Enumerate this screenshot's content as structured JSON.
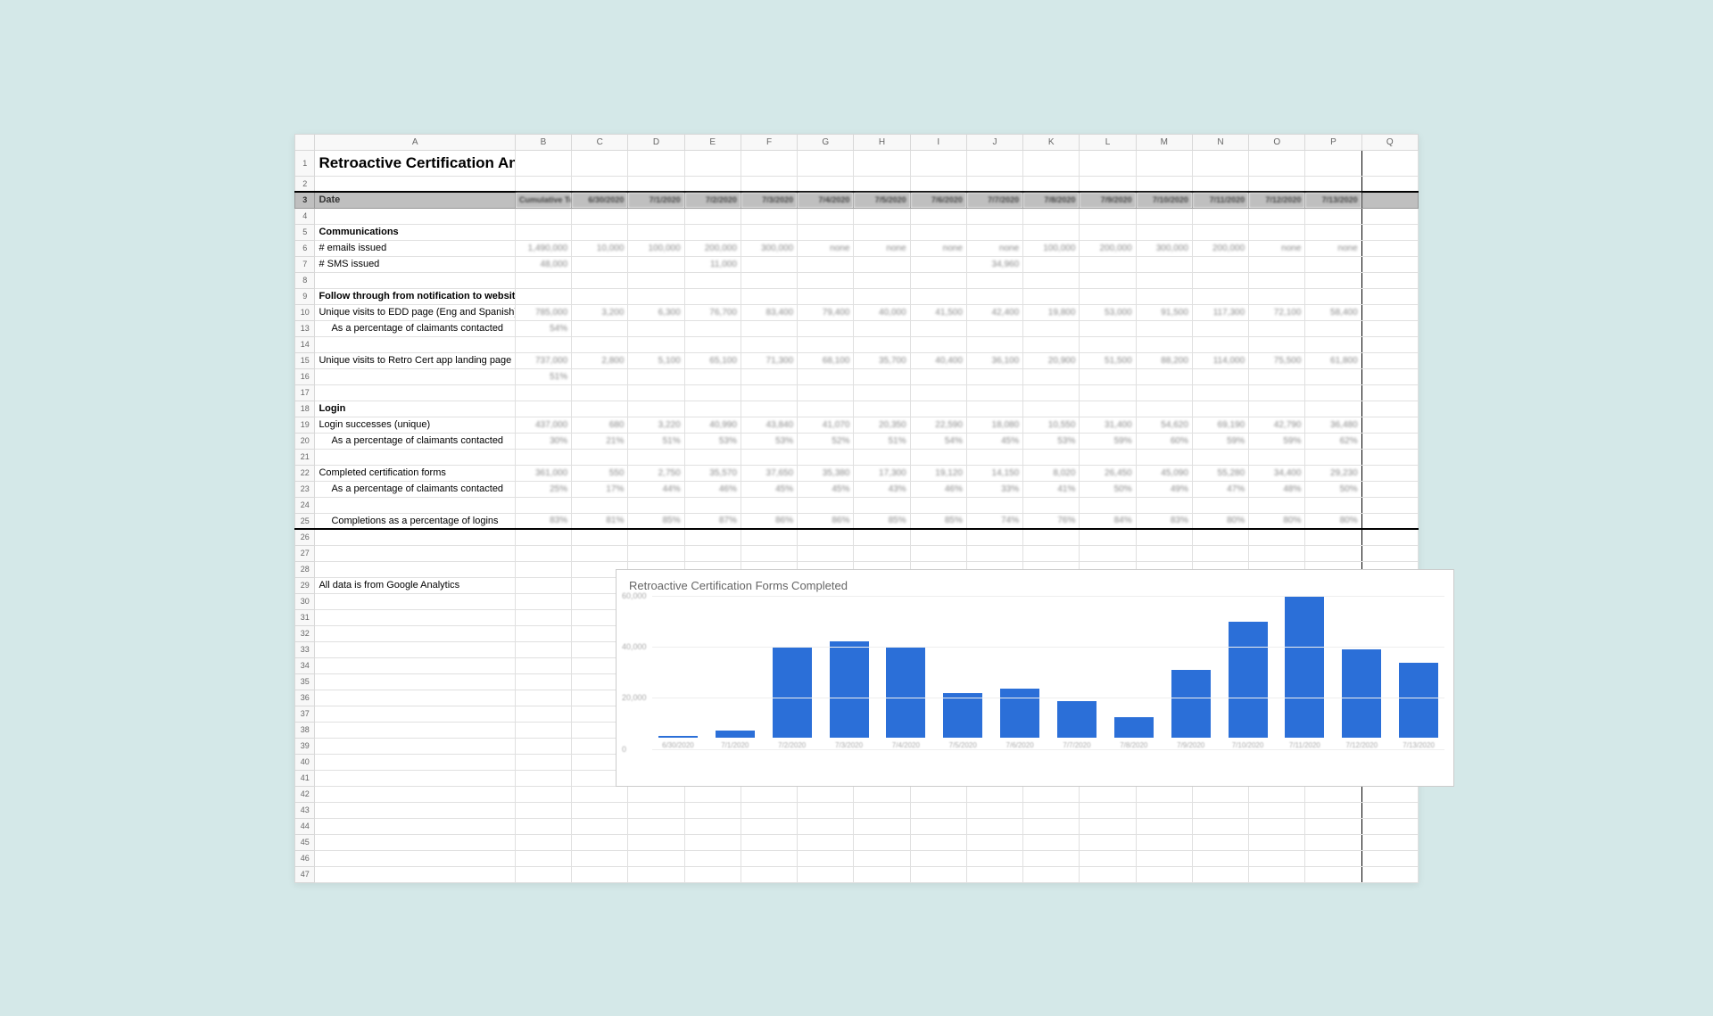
{
  "columns": [
    "",
    "A",
    "B",
    "C",
    "D",
    "E",
    "F",
    "G",
    "H",
    "I",
    "J",
    "K",
    "L",
    "M",
    "N",
    "O",
    "P",
    "Q"
  ],
  "title": "Retroactive Certification Analytics Summary",
  "header_row": {
    "label": "Date",
    "cells": [
      "Cumulative Total",
      "6/30/2020",
      "7/1/2020",
      "7/2/2020",
      "7/3/2020",
      "7/4/2020",
      "7/5/2020",
      "7/6/2020",
      "7/7/2020",
      "7/8/2020",
      "7/9/2020",
      "7/10/2020",
      "7/11/2020",
      "7/12/2020",
      "7/13/2020",
      ""
    ]
  },
  "rows": [
    {
      "n": 4,
      "label": "",
      "cells": []
    },
    {
      "n": 5,
      "label": "Communications",
      "sec": true,
      "cells": []
    },
    {
      "n": 6,
      "label": "# emails issued",
      "cells": [
        "1,490,000",
        "10,000",
        "100,000",
        "200,000",
        "300,000",
        "none",
        "none",
        "none",
        "none",
        "100,000",
        "200,000",
        "300,000",
        "200,000",
        "none",
        "none",
        ""
      ]
    },
    {
      "n": 7,
      "label": "# SMS issued",
      "cells": [
        "48,000",
        "",
        "",
        "11,000",
        "",
        "",
        "",
        "",
        "34,960",
        "",
        "",
        "",
        "",
        "",
        "",
        ""
      ]
    },
    {
      "n": 8,
      "label": "",
      "cells": []
    },
    {
      "n": 9,
      "label": "Follow through from notification to website",
      "sec": true,
      "cells": []
    },
    {
      "n": 10,
      "label": "Unique visits to EDD page (Eng and Spanish)",
      "cells": [
        "785,000",
        "3,200",
        "6,300",
        "76,700",
        "83,400",
        "79,400",
        "40,000",
        "41,500",
        "42,400",
        "19,800",
        "53,000",
        "91,500",
        "117,300",
        "72,100",
        "58,400",
        ""
      ]
    },
    {
      "n": 13,
      "label": "As a percentage of claimants contacted",
      "indent": true,
      "cells": [
        "54%",
        "",
        "",
        "",
        "",
        "",
        "",
        "",
        "",
        "",
        "",
        "",
        "",
        "",
        "",
        ""
      ]
    },
    {
      "n": 14,
      "label": "",
      "cells": []
    },
    {
      "n": 15,
      "label": "Unique visits to Retro Cert app landing page",
      "cells": [
        "737,000",
        "2,800",
        "5,100",
        "65,100",
        "71,300",
        "68,100",
        "35,700",
        "40,400",
        "36,100",
        "20,900",
        "51,500",
        "88,200",
        "114,000",
        "75,500",
        "61,800",
        ""
      ]
    },
    {
      "n": 16,
      "label": "",
      "indent": true,
      "cells": [
        "51%",
        "",
        "",
        "",
        "",
        "",
        "",
        "",
        "",
        "",
        "",
        "",
        "",
        "",
        "",
        ""
      ]
    },
    {
      "n": 17,
      "label": "",
      "cells": []
    },
    {
      "n": 18,
      "label": "Login",
      "sec": true,
      "cells": []
    },
    {
      "n": 19,
      "label": "Login successes (unique)",
      "cells": [
        "437,000",
        "680",
        "3,220",
        "40,990",
        "43,840",
        "41,070",
        "20,350",
        "22,590",
        "18,080",
        "10,550",
        "31,400",
        "54,620",
        "69,190",
        "42,790",
        "36,480",
        ""
      ]
    },
    {
      "n": 20,
      "label": "As a percentage of claimants contacted",
      "indent": true,
      "cells": [
        "30%",
        "21%",
        "51%",
        "53%",
        "53%",
        "52%",
        "51%",
        "54%",
        "45%",
        "53%",
        "59%",
        "60%",
        "59%",
        "59%",
        "62%",
        ""
      ]
    },
    {
      "n": 21,
      "label": "",
      "cells": []
    },
    {
      "n": 22,
      "label": "Completed certification forms",
      "cells": [
        "361,000",
        "550",
        "2,750",
        "35,570",
        "37,650",
        "35,380",
        "17,300",
        "19,120",
        "14,150",
        "8,020",
        "26,450",
        "45,090",
        "55,280",
        "34,400",
        "29,230",
        ""
      ]
    },
    {
      "n": 23,
      "label": "As a percentage of claimants contacted",
      "indent": true,
      "cells": [
        "25%",
        "17%",
        "44%",
        "46%",
        "45%",
        "45%",
        "43%",
        "46%",
        "33%",
        "41%",
        "50%",
        "49%",
        "47%",
        "48%",
        "50%",
        ""
      ]
    },
    {
      "n": 24,
      "label": "",
      "cells": []
    },
    {
      "n": 25,
      "label": "Completions as a percentage of logins",
      "indent": true,
      "cells": [
        "83%",
        "81%",
        "85%",
        "87%",
        "86%",
        "86%",
        "85%",
        "85%",
        "74%",
        "76%",
        "84%",
        "83%",
        "80%",
        "80%",
        "80%",
        ""
      ]
    }
  ],
  "empty_rows": [
    26,
    27,
    28,
    29,
    30,
    31,
    32,
    33,
    34,
    35,
    36,
    37,
    38,
    39,
    40,
    41,
    42,
    43,
    44,
    45,
    46,
    47
  ],
  "note_row": {
    "n": 29,
    "text": "All data is from Google Analytics"
  },
  "chart_data": {
    "type": "bar",
    "title": "Retroactive Certification Forms Completed",
    "ylabel": "",
    "xlabel": "",
    "ylim": [
      0,
      60000
    ],
    "yticks": [
      0,
      20000,
      40000,
      60000
    ],
    "categories": [
      "6/30/2020",
      "7/1/2020",
      "7/2/2020",
      "7/3/2020",
      "7/4/2020",
      "7/5/2020",
      "7/6/2020",
      "7/7/2020",
      "7/8/2020",
      "7/9/2020",
      "7/10/2020",
      "7/11/2020",
      "7/12/2020",
      "7/13/2020"
    ],
    "values": [
      550,
      2750,
      35570,
      37650,
      35380,
      17300,
      19120,
      14150,
      8020,
      26450,
      45090,
      55280,
      34400,
      29230
    ]
  }
}
